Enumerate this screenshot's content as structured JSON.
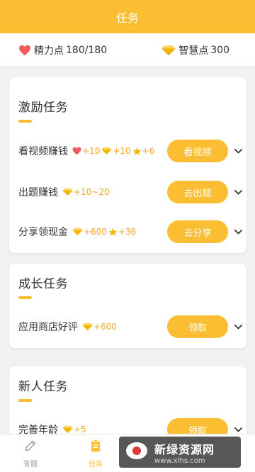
{
  "header": {
    "title": "任务"
  },
  "stats": {
    "energy": {
      "label": "精力点",
      "value": "180/180",
      "icon": "heart-icon",
      "color": "#f25b5b"
    },
    "wisdom": {
      "label": "智慧点",
      "value": "300",
      "icon": "diamond-icon",
      "color": "#f5b400"
    }
  },
  "sections": [
    {
      "title": "激励任务",
      "tasks": [
        {
          "title": "看视频赚钱",
          "rewards": [
            {
              "icon": "heart-icon",
              "text": "+10"
            },
            {
              "icon": "diamond-icon",
              "text": "+10"
            },
            {
              "icon": "star-icon",
              "text": "+6"
            }
          ],
          "button": "看视频"
        },
        {
          "title": "出题赚钱",
          "rewards": [
            {
              "icon": "diamond-icon",
              "text": "+10~20"
            }
          ],
          "button": "去出题"
        },
        {
          "title": "分享领现金",
          "rewards": [
            {
              "icon": "diamond-icon",
              "text": "+600"
            },
            {
              "icon": "star-icon",
              "text": "+36"
            }
          ],
          "button": "去分享"
        }
      ]
    },
    {
      "title": "成长任务",
      "tasks": [
        {
          "title": "应用商店好评",
          "rewards": [
            {
              "icon": "diamond-icon",
              "text": "+600"
            }
          ],
          "button": "领取"
        }
      ]
    },
    {
      "title": "新人任务",
      "tasks": [
        {
          "title": "完善年龄",
          "rewards": [
            {
              "icon": "diamond-icon",
              "text": "+5"
            }
          ],
          "button": "领取"
        }
      ]
    }
  ],
  "tabbar": {
    "items": [
      {
        "label": "答题",
        "icon": "pencil-icon",
        "active": false
      },
      {
        "label": "任务",
        "icon": "clipboard-icon",
        "active": true
      }
    ]
  },
  "watermark": {
    "title": "新绿资源网",
    "url": "www.xlhs.com"
  },
  "colors": {
    "accent": "#fbbd32",
    "reward_text": "#f5a623",
    "heart": "#f25b5b",
    "diamond": "#f5b400",
    "background": "#f2f2f2"
  }
}
